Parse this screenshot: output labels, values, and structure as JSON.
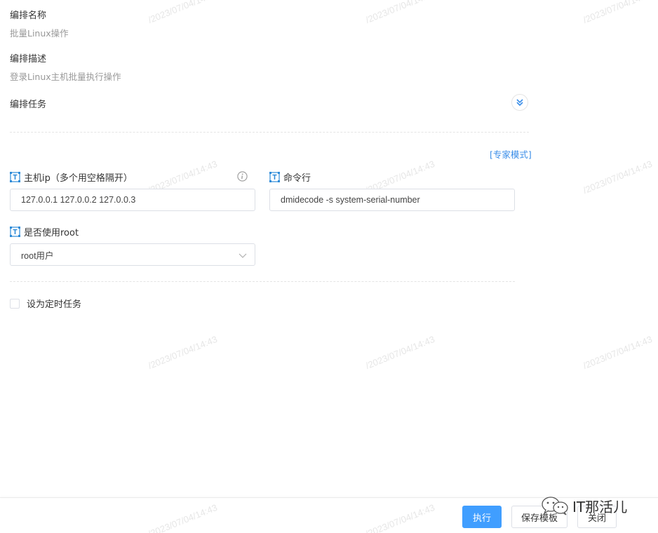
{
  "watermark": "/2023/07/04/14:43",
  "form": {
    "name_label": "编排名称",
    "name_value": "批量Linux操作",
    "desc_label": "编排描述",
    "desc_value": "登录Linux主机批量执行操作",
    "tasks_label": "编排任务",
    "expert_mode": "[专家模式]"
  },
  "fields": {
    "host_ip": {
      "label": "主机ip（多个用空格隔开）",
      "value": "127.0.0.1 127.0.0.2 127.0.0.3"
    },
    "command": {
      "label": "命令行",
      "value": "dmidecode -s system-serial-number"
    },
    "use_root": {
      "label": "是否使用root",
      "selected": "root用户"
    }
  },
  "schedule": {
    "label": "设为定时任务",
    "checked": false
  },
  "footer": {
    "execute": "执行",
    "save_template": "保存模板",
    "close": "关闭"
  },
  "brand": {
    "text": "IT那活儿"
  },
  "colors": {
    "primary": "#409eff",
    "link": "#3b8ee8",
    "icon": "#2e8bd8"
  },
  "icons": [
    "double-chevron-down-icon",
    "text-field-icon",
    "info-icon",
    "chevron-down-icon",
    "wechat-icon"
  ]
}
